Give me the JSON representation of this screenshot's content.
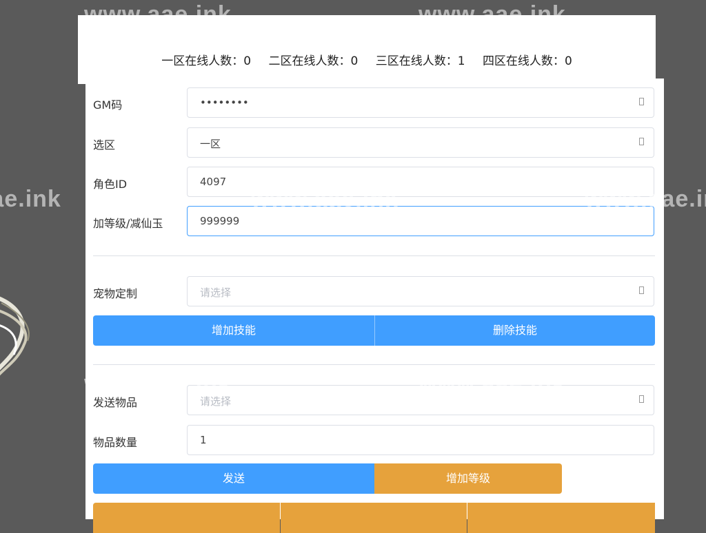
{
  "watermark": "www.aae.ink",
  "stats": [
    {
      "label": "一区在线人数：",
      "value": "0"
    },
    {
      "label": "二区在线人数：",
      "value": "0"
    },
    {
      "label": "三区在线人数：",
      "value": "1"
    },
    {
      "label": "四区在线人数：",
      "value": "0"
    }
  ],
  "form": {
    "gm": {
      "label": "GM码",
      "value": "••••••••"
    },
    "zone": {
      "label": "选区",
      "value": "一区"
    },
    "role_id": {
      "label": "角色ID",
      "value": "4097"
    },
    "level": {
      "label": "加等级/减仙玉",
      "value": "999999"
    },
    "pet": {
      "label": "宠物定制",
      "placeholder": "请选择"
    },
    "add_skill": "增加技能",
    "del_skill": "删除技能",
    "item": {
      "label": "发送物品",
      "placeholder": "请选择"
    },
    "qty": {
      "label": "物品数量",
      "value": "1"
    },
    "send": "发送",
    "add_level": "增加等级"
  },
  "colors": {
    "primary": "#409eff",
    "warning": "#e6a23c",
    "background": "#5a5a5a"
  }
}
